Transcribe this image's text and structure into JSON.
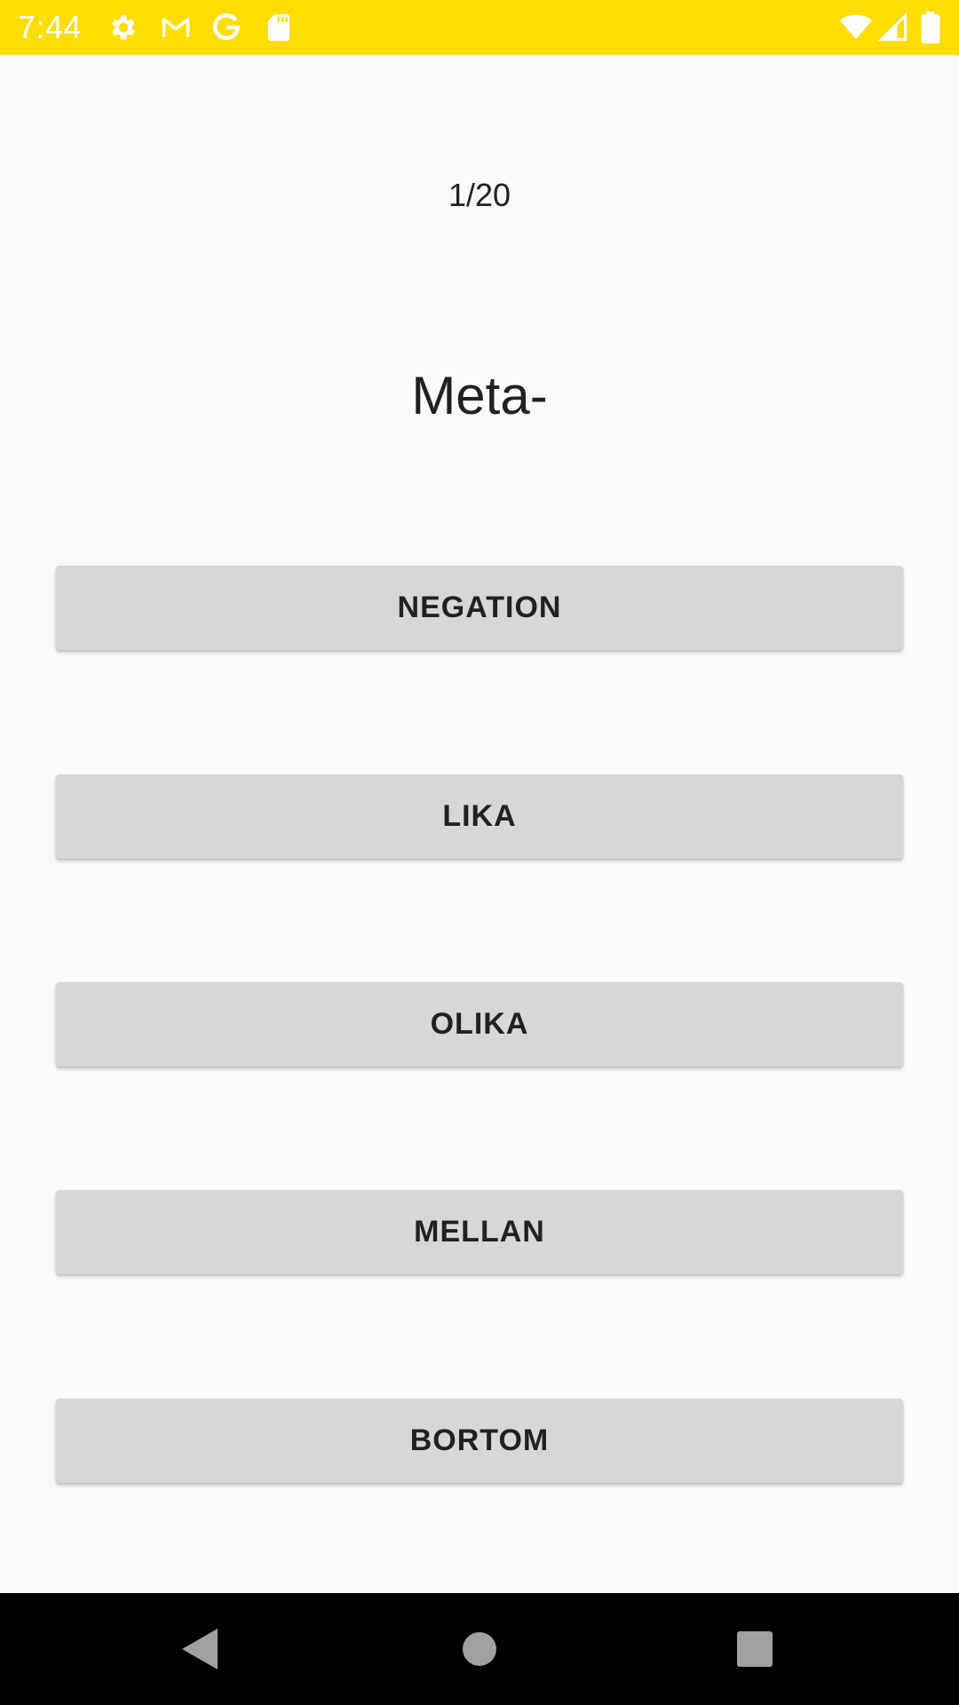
{
  "status_bar": {
    "time": "7:44",
    "background_color": "#ffdd00",
    "left_icons": [
      "settings-icon",
      "gmail-icon",
      "google-icon",
      "sd-card-icon"
    ],
    "right_icons": [
      "wifi-icon",
      "cell-signal-icon",
      "battery-icon"
    ]
  },
  "quiz": {
    "counter": "1/20",
    "prompt": "Meta-",
    "options": [
      {
        "label": "NEGATION"
      },
      {
        "label": "LIKA"
      },
      {
        "label": "OLIKA"
      },
      {
        "label": "MELLAN"
      },
      {
        "label": "BORTOM"
      }
    ],
    "button_color": "#d6d7d7"
  },
  "nav_bar": {
    "icons": [
      "back-icon",
      "home-icon",
      "recents-icon"
    ]
  }
}
